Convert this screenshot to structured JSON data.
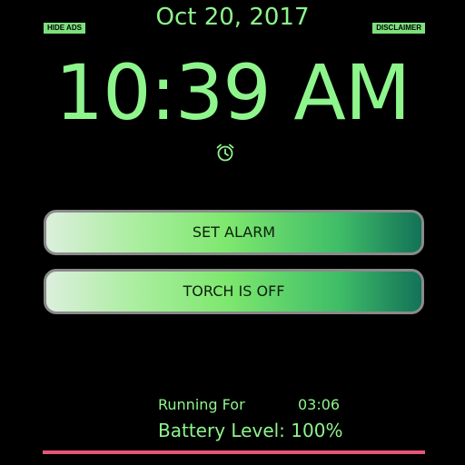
{
  "header": {
    "date": "Oct 20, 2017",
    "hide_ads_label": "HIDE ADS",
    "disclaimer_label": "DISCLAIMER"
  },
  "clock": {
    "time": "10:39 AM",
    "alarm_icon": "alarm-clock-icon"
  },
  "buttons": {
    "set_alarm": "SET ALARM",
    "torch": "TORCH IS OFF"
  },
  "status": {
    "running_label": "Running For",
    "running_value": "03:06",
    "battery": "Battery Level: 100%"
  },
  "colors": {
    "text": "#8ef58c",
    "background": "#000000",
    "bar": "#e8547a"
  }
}
